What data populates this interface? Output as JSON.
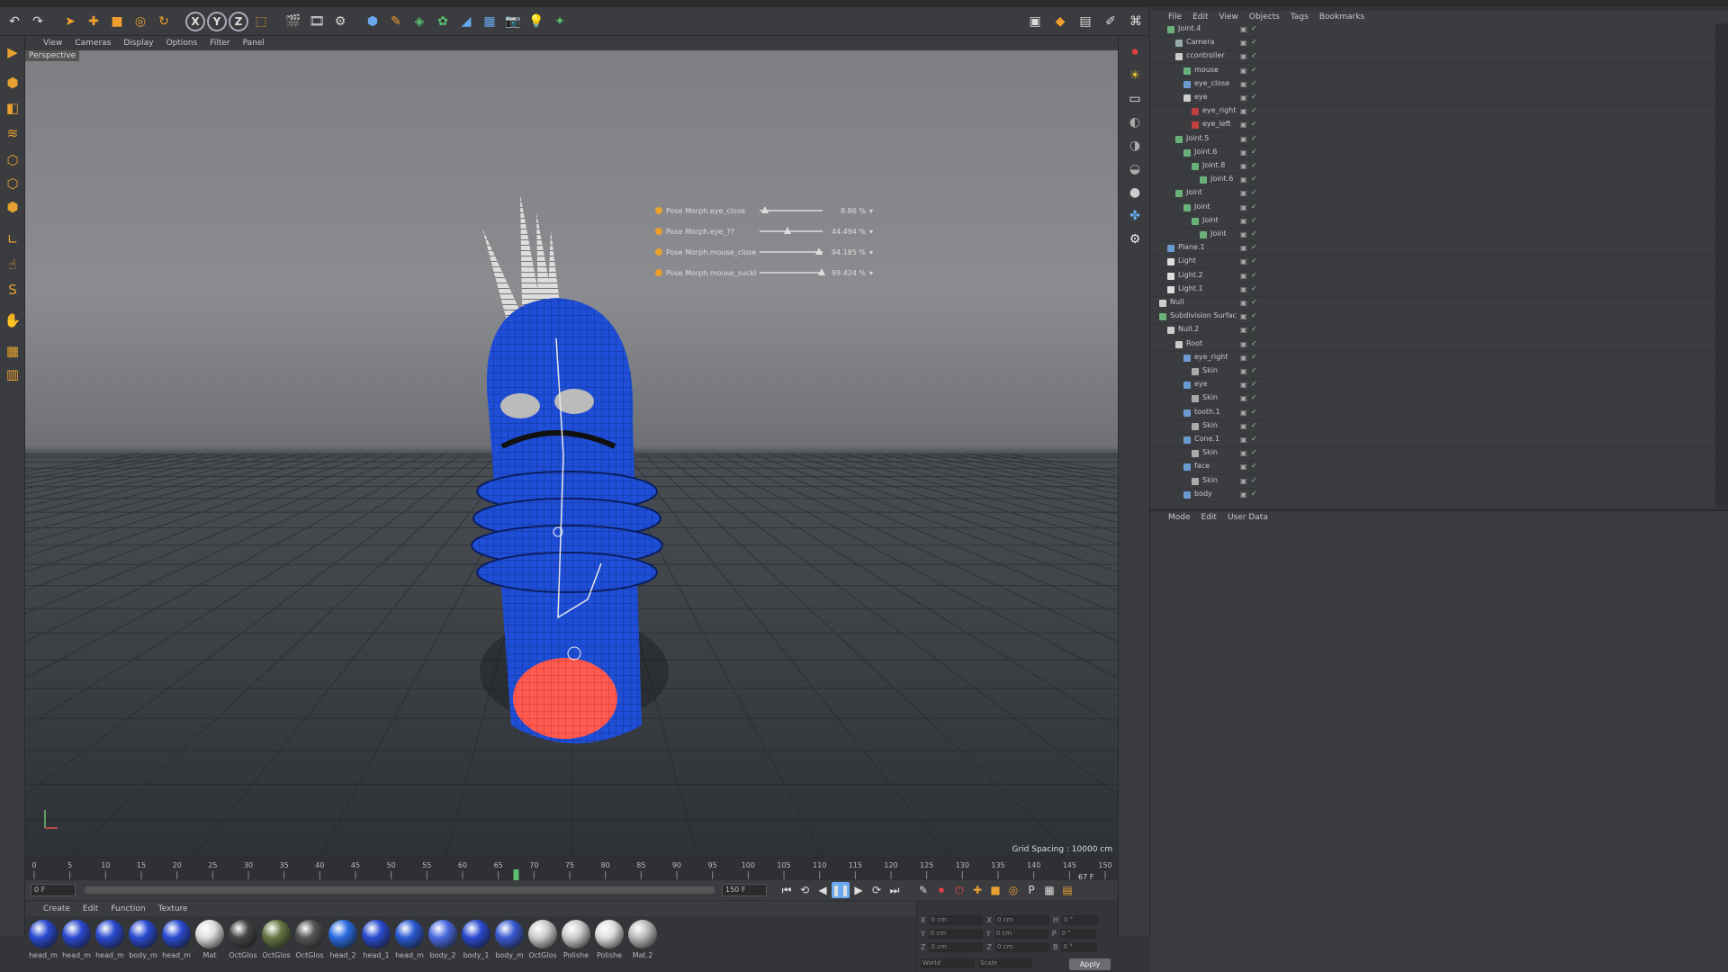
{
  "viewport": {
    "menu": [
      "View",
      "Cameras",
      "Display",
      "Options",
      "Filter",
      "Panel"
    ],
    "label": "Perspective",
    "grid_spacing": "Grid Spacing : 10000 cm"
  },
  "pose_morphs": [
    {
      "label": "Pose Morph.eye_close",
      "value": "8.86 %",
      "fraction": 0.09
    },
    {
      "label": "Pose Morph.eye_??",
      "value": "44.494 %",
      "fraction": 0.44
    },
    {
      "label": "Pose Morph.mouse_close",
      "value": "94.185 %",
      "fraction": 0.94
    },
    {
      "label": "Pose Morph.mouse_suckkiss",
      "value": "99.424 %",
      "fraction": 0.99
    }
  ],
  "object_manager": {
    "menu": [
      "File",
      "Edit",
      "View",
      "Objects",
      "Tags",
      "Bookmarks"
    ],
    "rows": [
      {
        "name": "Joint.4",
        "depth": 1,
        "color": "#6ab07a"
      },
      {
        "name": "Camera",
        "depth": 2,
        "color": "#9aa"
      },
      {
        "name": "ccontroller",
        "depth": 2,
        "color": "#ccc"
      },
      {
        "name": "mouse",
        "depth": 3,
        "color": "#6ab07a"
      },
      {
        "name": "eye_close",
        "depth": 3,
        "color": "#6a9ad0"
      },
      {
        "name": "eye",
        "depth": 3,
        "color": "#ccc"
      },
      {
        "name": "eye_right",
        "depth": 4,
        "color": "#c04040"
      },
      {
        "name": "eye_left",
        "depth": 4,
        "color": "#c04040"
      },
      {
        "name": "Joint.5",
        "depth": 2,
        "color": "#6ab07a"
      },
      {
        "name": "Joint.6",
        "depth": 3,
        "color": "#6ab07a"
      },
      {
        "name": "Joint.8",
        "depth": 4,
        "color": "#6ab07a"
      },
      {
        "name": "Joint.6",
        "depth": 5,
        "color": "#6ab07a"
      },
      {
        "name": "Joint",
        "depth": 2,
        "color": "#6ab07a"
      },
      {
        "name": "Joint",
        "depth": 3,
        "color": "#6ab07a"
      },
      {
        "name": "Joint",
        "depth": 4,
        "color": "#6ab07a"
      },
      {
        "name": "Joint",
        "depth": 5,
        "color": "#6ab07a"
      },
      {
        "name": "Plane.1",
        "depth": 1,
        "color": "#6a9ad0"
      },
      {
        "name": "Light",
        "depth": 1,
        "color": "#ddd"
      },
      {
        "name": "Light.2",
        "depth": 1,
        "color": "#ddd"
      },
      {
        "name": "Light.1",
        "depth": 1,
        "color": "#ddd"
      },
      {
        "name": "Null",
        "depth": 0,
        "color": "#ccc"
      },
      {
        "name": "Subdivision Surfac",
        "depth": 0,
        "color": "#6ab07a"
      },
      {
        "name": "Null.2",
        "depth": 1,
        "color": "#ccc"
      },
      {
        "name": "Root",
        "depth": 2,
        "color": "#ccc"
      },
      {
        "name": "eye_right",
        "depth": 3,
        "color": "#6a9ad0"
      },
      {
        "name": "Skin",
        "depth": 4,
        "color": "#aaa"
      },
      {
        "name": "eye",
        "depth": 3,
        "color": "#6a9ad0"
      },
      {
        "name": "Skin",
        "depth": 4,
        "color": "#aaa"
      },
      {
        "name": "tooth.1",
        "depth": 3,
        "color": "#6a9ad0"
      },
      {
        "name": "Skin",
        "depth": 4,
        "color": "#aaa"
      },
      {
        "name": "Cone.1",
        "depth": 3,
        "color": "#6a9ad0"
      },
      {
        "name": "Skin",
        "depth": 4,
        "color": "#aaa"
      },
      {
        "name": "face",
        "depth": 3,
        "color": "#6a9ad0"
      },
      {
        "name": "Skin",
        "depth": 4,
        "color": "#aaa"
      },
      {
        "name": "body",
        "depth": 3,
        "color": "#6a9ad0"
      }
    ]
  },
  "attribute_manager": {
    "menu": [
      "Mode",
      "Edit",
      "User Data"
    ]
  },
  "timeline": {
    "ticks": [
      "0",
      "5",
      "10",
      "15",
      "20",
      "25",
      "30",
      "35",
      "40",
      "45",
      "50",
      "55",
      "60",
      "65",
      "70",
      "75",
      "80",
      "85",
      "90",
      "95",
      "100",
      "105",
      "110",
      "115",
      "120",
      "125",
      "130",
      "135",
      "140",
      "145",
      "150"
    ],
    "current_frame_fraction": 0.45,
    "start_field": "0 F",
    "end_field": "150 F",
    "current_field": "67 F"
  },
  "material_manager": {
    "menu": [
      "Create",
      "Edit",
      "Function",
      "Texture"
    ],
    "materials": [
      {
        "label": "head_m",
        "color": "#2a4ad0"
      },
      {
        "label": "head_m",
        "color": "#2a4ad0"
      },
      {
        "label": "head_m",
        "color": "#2a4ad0"
      },
      {
        "label": "body_m",
        "color": "#2a4ad0"
      },
      {
        "label": "head_m",
        "color": "#2a4ad0"
      },
      {
        "label": "Mat",
        "color": "#dddddd"
      },
      {
        "label": "OctGlos",
        "color": "#444444"
      },
      {
        "label": "OctGlos",
        "color": "#667744"
      },
      {
        "label": "OctGlos",
        "color": "#555555"
      },
      {
        "label": "head_2",
        "color": "#2a6ae0"
      },
      {
        "label": "head_1",
        "color": "#2a4ad0"
      },
      {
        "label": "head_m",
        "color": "#2a5ad0"
      },
      {
        "label": "body_2",
        "color": "#4a6ae0"
      },
      {
        "label": "body_1",
        "color": "#2a4ad0"
      },
      {
        "label": "body_m",
        "color": "#3a5ad0"
      },
      {
        "label": "OctGlos",
        "color": "#cccccc"
      },
      {
        "label": "Polishe",
        "color": "#cccccc"
      },
      {
        "label": "Polishe",
        "color": "#dddddd"
      },
      {
        "label": "Mat.2",
        "color": "#bbbbbb"
      }
    ]
  },
  "coordinates": {
    "rows": [
      {
        "a": "X",
        "av": "0 cm",
        "b": "X",
        "bv": "0 cm",
        "c": "H",
        "cv": "0 °"
      },
      {
        "a": "Y",
        "av": "0 cm",
        "b": "Y",
        "bv": "0 cm",
        "c": "P",
        "cv": "0 °"
      },
      {
        "a": "Z",
        "av": "0 cm",
        "b": "Z",
        "bv": "0 cm",
        "c": "B",
        "cv": "0 °"
      }
    ],
    "mode_left": "World",
    "mode_right": "Scale",
    "apply_label": "Apply"
  }
}
